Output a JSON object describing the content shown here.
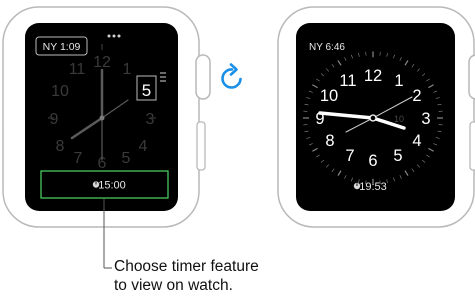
{
  "left_watch": {
    "complication_top_left": "NY 1:09",
    "date_box": "5",
    "timer_complication": "15:00",
    "hour_numerals": [
      "12",
      "1",
      "2",
      "3",
      "4",
      "5",
      "6",
      "7",
      "8",
      "9",
      "10",
      "11"
    ]
  },
  "right_watch": {
    "complication_top_left": "NY 6:46",
    "timer_complication": "19:53",
    "hour_numerals": [
      "12",
      "1",
      "2",
      "3",
      "4",
      "5",
      "6",
      "7",
      "8",
      "9",
      "10",
      "11"
    ],
    "subdial_value": "10"
  },
  "callout": {
    "line1": "Choose timer feature",
    "line2": "to view on watch."
  },
  "colors": {
    "edit_green": "#4cd964",
    "rotate_arrow": "#1a90e8"
  },
  "icons": [
    "digital-crown-rotate-icon",
    "timer-icon"
  ]
}
